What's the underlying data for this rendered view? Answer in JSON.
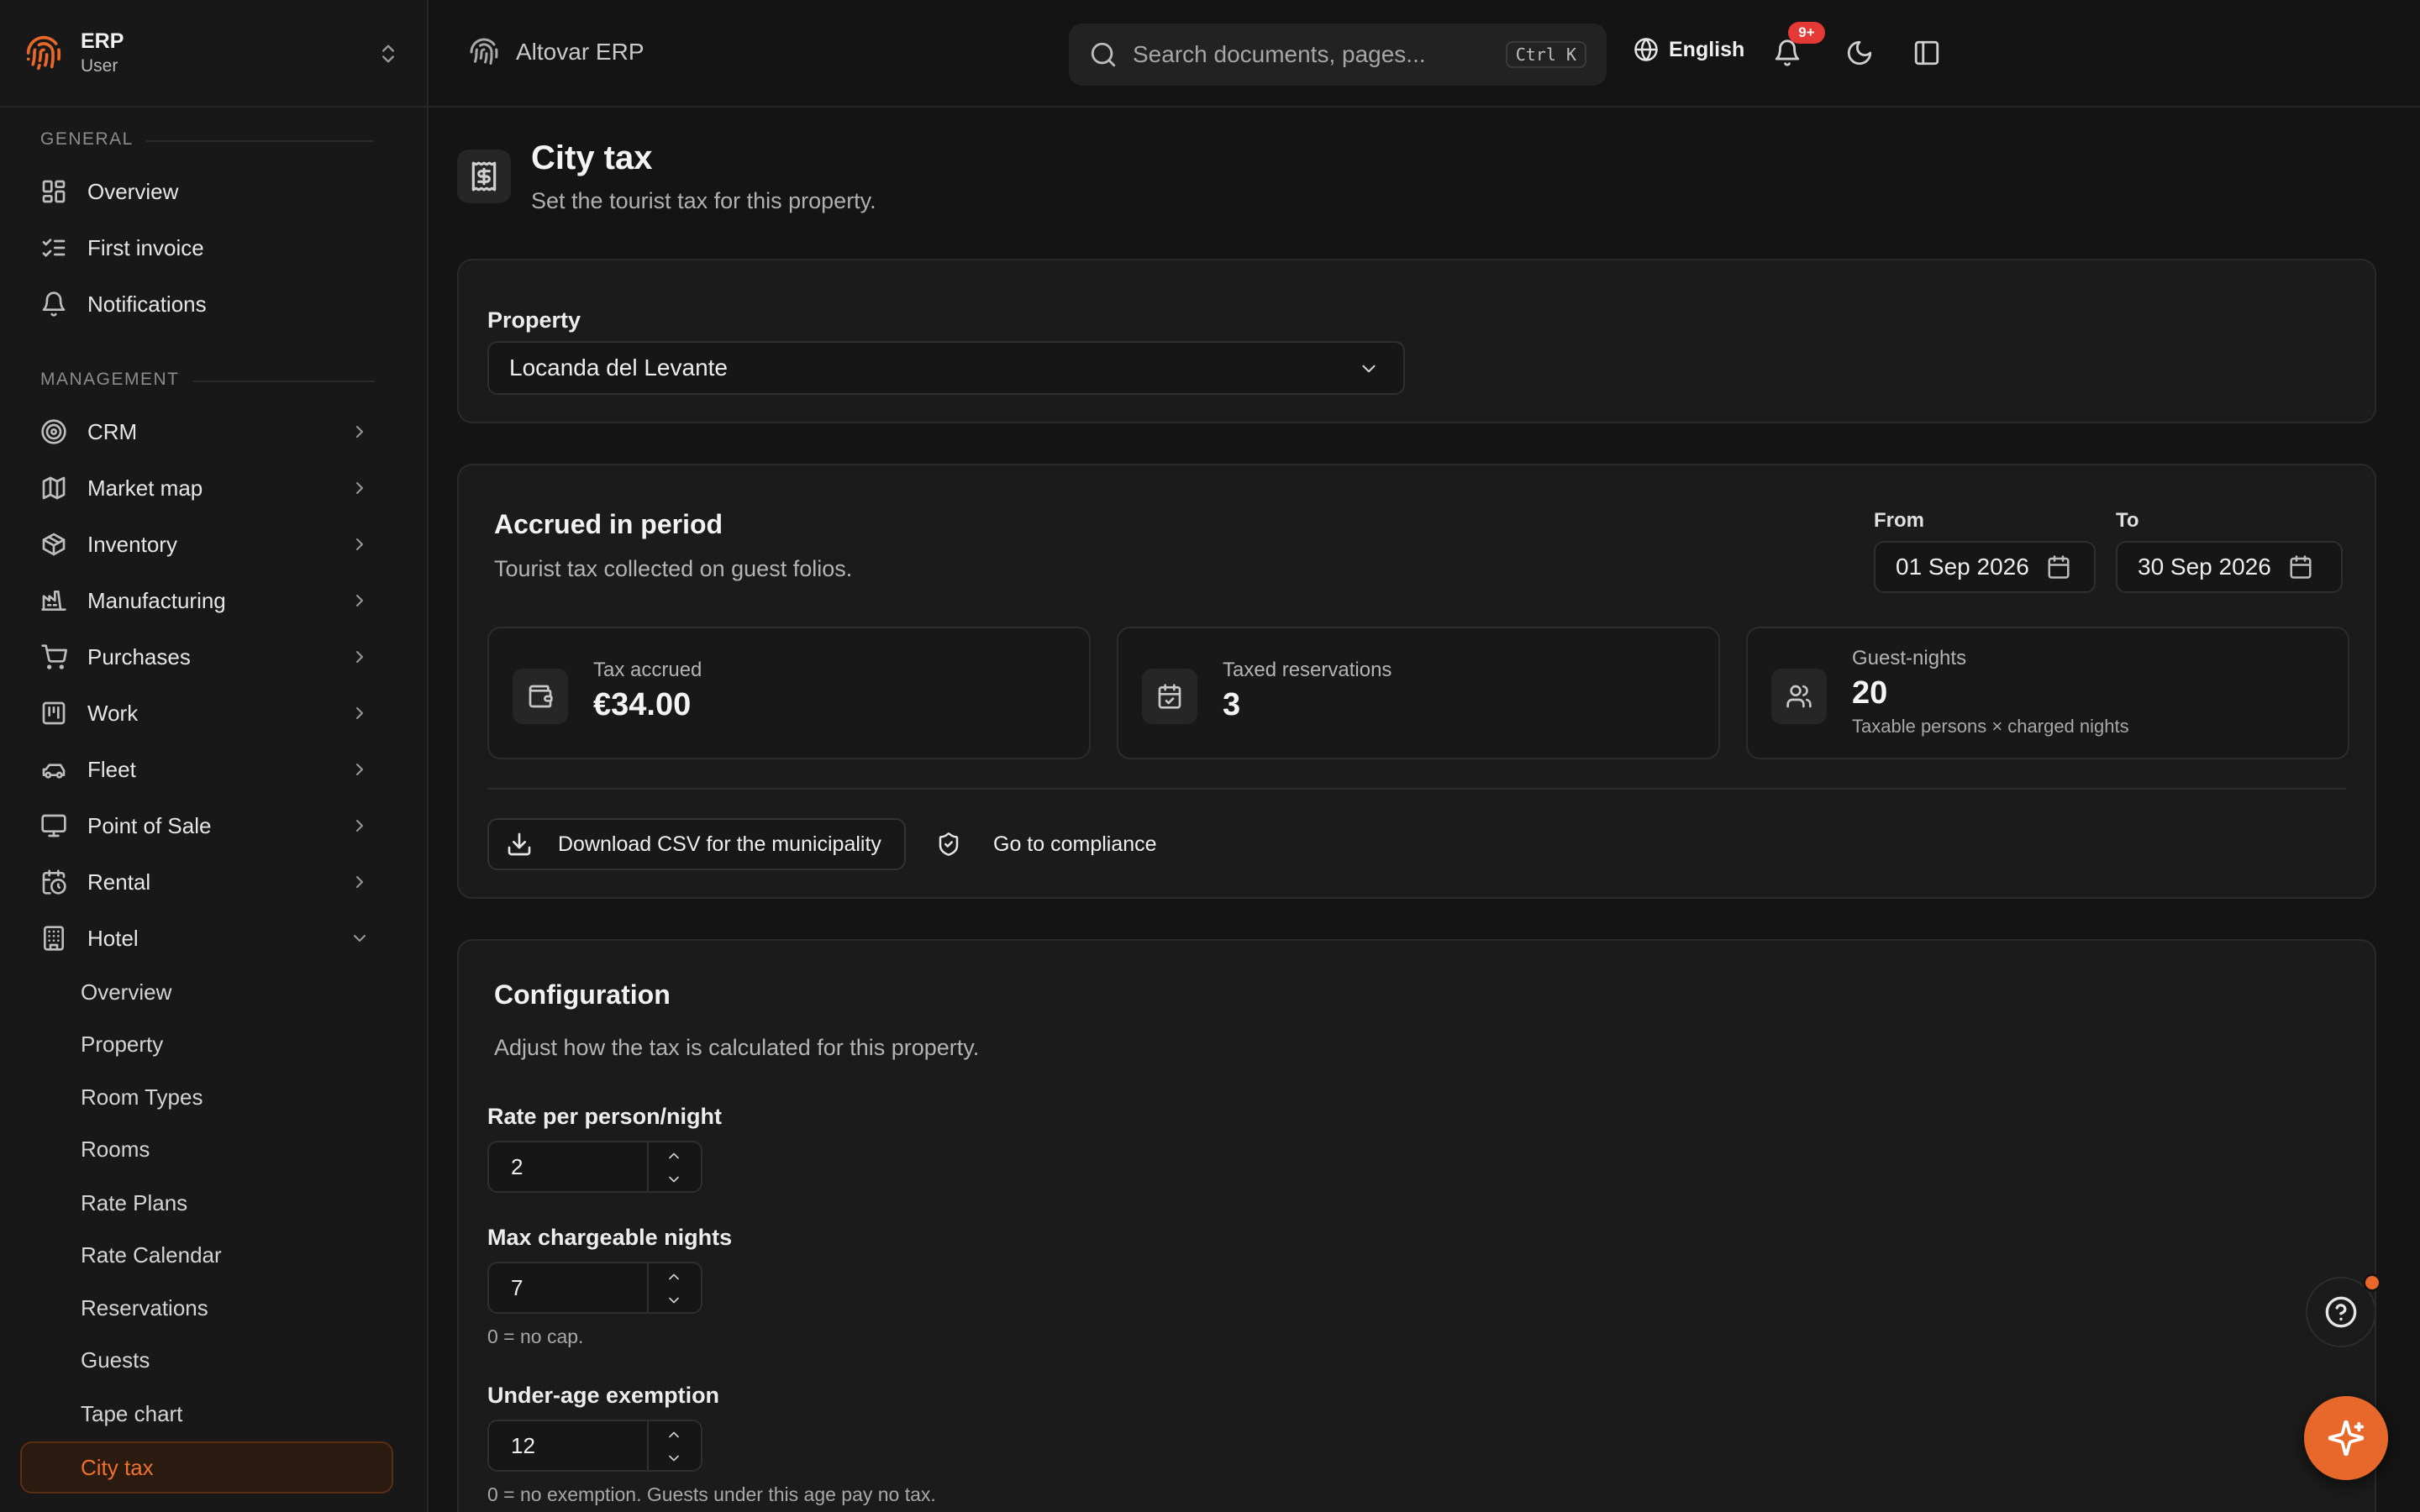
{
  "brand": {
    "name": "ERP",
    "role": "User"
  },
  "sidebar": {
    "general_label": "General",
    "general_items": [
      {
        "label": "Overview",
        "icon": "dashboard-icon"
      },
      {
        "label": "First invoice",
        "icon": "checklist-icon"
      },
      {
        "label": "Notifications",
        "icon": "bell-icon"
      }
    ],
    "management_label": "Management",
    "management_items": [
      {
        "label": "CRM",
        "icon": "target-icon"
      },
      {
        "label": "Market map",
        "icon": "map-icon"
      },
      {
        "label": "Inventory",
        "icon": "package-icon"
      },
      {
        "label": "Manufacturing",
        "icon": "factory-icon"
      },
      {
        "label": "Purchases",
        "icon": "cart-icon"
      },
      {
        "label": "Work",
        "icon": "kanban-icon"
      },
      {
        "label": "Fleet",
        "icon": "car-icon"
      },
      {
        "label": "Point of Sale",
        "icon": "monitor-icon"
      },
      {
        "label": "Rental",
        "icon": "calendar-clock-icon"
      },
      {
        "label": "Hotel",
        "icon": "building-icon"
      }
    ],
    "hotel_items": [
      {
        "label": "Overview"
      },
      {
        "label": "Property"
      },
      {
        "label": "Room Types"
      },
      {
        "label": "Rooms"
      },
      {
        "label": "Rate Plans"
      },
      {
        "label": "Rate Calendar"
      },
      {
        "label": "Reservations"
      },
      {
        "label": "Guests"
      },
      {
        "label": "Tape chart"
      },
      {
        "label": "City tax"
      }
    ]
  },
  "topbar": {
    "app_title": "Altovar ERP",
    "search_placeholder": "Search documents, pages...",
    "search_shortcut": "Ctrl K",
    "language": "English",
    "notification_badge": "9+"
  },
  "page": {
    "title": "City tax",
    "subtitle": "Set the tourist tax for this property."
  },
  "property_card": {
    "label": "Property",
    "selected": "Locanda del Levante"
  },
  "accrued_card": {
    "title": "Accrued in period",
    "description": "Tourist tax collected on guest folios.",
    "from_label": "From",
    "from_value": "01 Sep 2026",
    "to_label": "To",
    "to_value": "30 Sep 2026",
    "stats": {
      "tax_accrued": {
        "label": "Tax accrued",
        "value": "€34.00"
      },
      "taxed_reservations": {
        "label": "Taxed reservations",
        "value": "3"
      },
      "guest_nights": {
        "label": "Guest-nights",
        "value": "20",
        "hint": "Taxable persons × charged nights"
      }
    },
    "download_label": "Download CSV for the municipality",
    "compliance_label": "Go to compliance"
  },
  "config_card": {
    "title": "Configuration",
    "description": "Adjust how the tax is calculated for this property.",
    "rate_label": "Rate per person/night",
    "rate_value": "2",
    "max_nights_label": "Max chargeable nights",
    "max_nights_value": "7",
    "max_nights_hint": "0 = no cap.",
    "underage_label": "Under-age exemption",
    "underage_value": "12",
    "underage_hint": "0 = no exemption. Guests under this age pay no tax."
  },
  "colors": {
    "accent": "#e8672a",
    "background": "#141414",
    "card": "#1b1b1b",
    "badge": "#e53935"
  }
}
